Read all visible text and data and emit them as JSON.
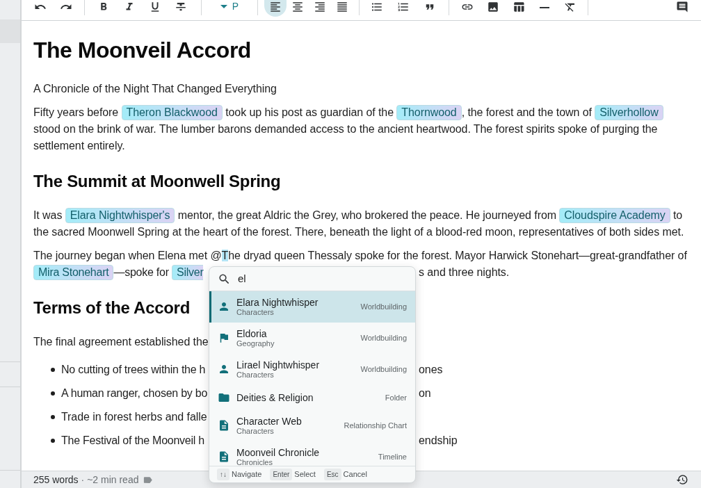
{
  "sidebar": {
    "rows": [
      {
        "selected": true
      }
    ]
  },
  "toolbar": {
    "block_style": "P",
    "alignment": [
      {
        "selected": true
      },
      {
        "selected": false
      },
      {
        "selected": false
      },
      {
        "selected": false
      }
    ]
  },
  "document": {
    "blocks": [
      {
        "kind": "h1",
        "text": "The Moonveil Accord"
      },
      {
        "kind": "p",
        "lines": [
          {
            "segments": [
              {
                "kind": "text",
                "text": "A Chronicle of the Night That Changed Everything"
              }
            ]
          }
        ]
      },
      {
        "kind": "p",
        "lines": [
          {
            "segments": [
              {
                "kind": "text",
                "text": "Fifty years before "
              },
              {
                "kind": "mention",
                "text": "Theron Blackwood"
              },
              {
                "kind": "text",
                "text": " took up his post as guardian of the "
              },
              {
                "kind": "mention",
                "text": "Thornwood"
              },
              {
                "kind": "text",
                "text": ", the forest and the town of "
              },
              {
                "kind": "mention",
                "text": "Silverhollow"
              }
            ]
          },
          {
            "segments": [
              {
                "kind": "text",
                "text": "stood on the brink of war. The lumber barons demanded access to the ancient heartwood. The forest spirits spoke of purging the"
              }
            ]
          },
          {
            "segments": [
              {
                "kind": "text",
                "text": "settlement entirely."
              }
            ]
          }
        ]
      },
      {
        "kind": "h2",
        "text": "The Summit at Moonwell Spring"
      },
      {
        "kind": "p",
        "lines": [
          {
            "segments": [
              {
                "kind": "text",
                "text": "It was "
              },
              {
                "kind": "mention",
                "text": "Elara Nightwhisper's"
              },
              {
                "kind": "text",
                "text": " mentor, the great Aldric the Grey, who brokered the peace. He journeyed from "
              },
              {
                "kind": "mention",
                "text": "Cloudspire Academy"
              },
              {
                "kind": "text",
                "text": " to"
              }
            ]
          },
          {
            "segments": [
              {
                "kind": "text",
                "text": "the sacred Moonwell Spring at the heart of the forest. There, beneath the light of a blood-red moon, representatives of both sides met."
              }
            ]
          }
        ]
      },
      {
        "kind": "p",
        "lines": [
          {
            "segments": [
              {
                "kind": "text",
                "text": "The journey began when Elena met @"
              },
              {
                "kind": "highlight",
                "text": "T"
              },
              {
                "kind": "text",
                "text": "he dryad queen Thessaly spoke for the forest. Mayor Harwick Stonehart—great-grandfather of"
              }
            ]
          },
          {
            "segments": [
              {
                "kind": "mention",
                "text": "Mira Stonehart"
              },
              {
                "kind": "text",
                "text": "—spoke for "
              },
              {
                "kind": "mention",
                "text": "Silver",
                "clipped": true
              }
            ],
            "right_of_popup": [
              {
                "kind": "text",
                "text": "s and three nights."
              }
            ]
          }
        ]
      },
      {
        "kind": "h2",
        "text": "Terms of the Accord"
      },
      {
        "kind": "p",
        "lines": [
          {
            "segments": [
              {
                "kind": "text",
                "text": "The final agreement established the"
              }
            ]
          }
        ]
      },
      {
        "kind": "list",
        "items": [
          {
            "segments": [
              {
                "kind": "text",
                "text": "No cutting of trees within the h"
              }
            ],
            "right_of_popup": [
              {
                "kind": "text",
                "text": "ones"
              }
            ]
          },
          {
            "segments": [
              {
                "kind": "text",
                "text": "A human ranger, chosen by bo"
              }
            ],
            "right_of_popup": [
              {
                "kind": "text",
                "text": "on"
              }
            ]
          },
          {
            "segments": [
              {
                "kind": "text",
                "text": "Trade in forest herbs and falle"
              }
            ]
          },
          {
            "segments": [
              {
                "kind": "text",
                "text": "The Festival of the Moonveil h"
              }
            ],
            "right_of_popup": [
              {
                "kind": "text",
                "text": "endship"
              }
            ]
          }
        ]
      }
    ]
  },
  "mention_popup": {
    "query": "el",
    "results": [
      {
        "name": "Elara Nightwhisper",
        "category": "Characters",
        "type": "Worldbuilding",
        "kind": "person",
        "selected": true
      },
      {
        "name": "Eldoria",
        "category": "Geography",
        "type": "Worldbuilding",
        "kind": "place",
        "selected": false
      },
      {
        "name": "Lirael Nightwhisper",
        "category": "Characters",
        "type": "Worldbuilding",
        "kind": "person",
        "selected": false
      },
      {
        "name": "Deities & Religion",
        "type": "Folder",
        "kind": "folder",
        "selected": false
      },
      {
        "name": "Character Web",
        "category": "Characters",
        "type": "Relationship Chart",
        "kind": "document",
        "selected": false
      },
      {
        "name": "Moonveil Chronicle",
        "category": "Chronicles",
        "type": "Timeline",
        "kind": "document",
        "selected": false
      }
    ],
    "hints": [
      {
        "key": "↑↓",
        "label": "Navigate"
      },
      {
        "key": "Enter",
        "label": "Select"
      },
      {
        "key": "Esc",
        "label": "Cancel"
      }
    ]
  },
  "status_bar": {
    "word_count": "255 words",
    "read_time": "· ~2 min read"
  }
}
